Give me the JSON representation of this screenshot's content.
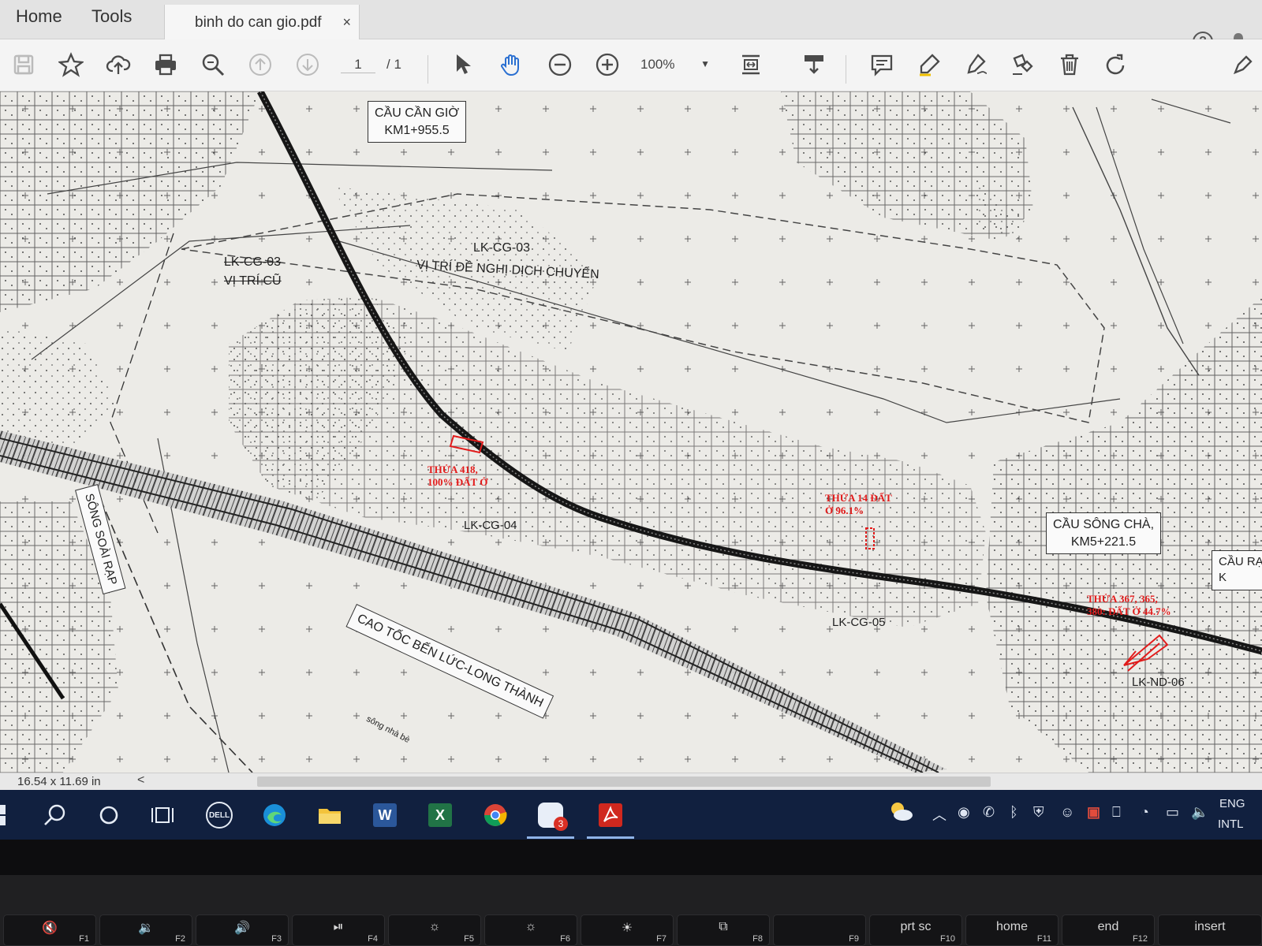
{
  "menu": {
    "home": "Home",
    "tools": "Tools"
  },
  "tab": {
    "title": "binh do can gio.pdf",
    "close": "×"
  },
  "header": {
    "help": "?"
  },
  "toolbar": {
    "page_current": "1",
    "page_total": "/ 1",
    "zoom": "100%"
  },
  "map": {
    "bridge_can_gio": {
      "line1": "CẦU CẦN GIỜ",
      "line2": "KM1+955.5"
    },
    "lk_cg_03_old": {
      "line1": "LK-CG-03",
      "line2": "VỊ TRÍ CŨ"
    },
    "lk_cg_03_new": {
      "line1": "LK-CG-03",
      "line2": "VỊ TRÍ ĐỀ NGHỊ DỊCH CHUYỂN"
    },
    "river_soai_rap": "SÔNG SOÀI RẠP",
    "highway": "CAO TỐC BẾN LỨC-LONG THÀNH",
    "lk_cg_04": "LK-CG-04",
    "lk_cg_05": "LK-CG-05",
    "lk_nd_06": "LK-ND-06",
    "bridge_song_cha": {
      "line1": "CẦU SÔNG CHÀ,",
      "line2": "KM5+221.5"
    },
    "bridge_ra": {
      "line1": "CẦU RẠ",
      "line2": "K"
    },
    "parcel_418": {
      "line1": "THỬA 418,",
      "line2": "100% ĐẤT Ở"
    },
    "parcel_14": {
      "line1": "THỬA 14 ĐẤT",
      "line2": "Ở 96.1%"
    },
    "parcel_367": {
      "line1": "THỬA 367, 365,",
      "line2": "380: ĐẤT Ở 44.7%"
    },
    "river_nha_be": "sông nhà bè"
  },
  "status": {
    "page_size": "16.54 x 11.69 in",
    "scroll_left": "<"
  },
  "taskbar": {
    "dell": "DELL",
    "word": "W",
    "excel": "X",
    "zalo_badge": "3",
    "lang_line1": "ENG",
    "lang_line2": "INTL"
  },
  "keyboard": {
    "keys": [
      {
        "fn": "F1",
        "main": "🔇"
      },
      {
        "fn": "F2",
        "main": "🔉"
      },
      {
        "fn": "F3",
        "main": "🔊"
      },
      {
        "fn": "F4",
        "main": "⏯"
      },
      {
        "fn": "F5",
        "main": "☼"
      },
      {
        "fn": "F6",
        "main": "☼"
      },
      {
        "fn": "F7",
        "main": "☀"
      },
      {
        "fn": "F8",
        "main": "⧉"
      },
      {
        "fn": "F9",
        "main": ""
      },
      {
        "fn": "F10",
        "main": "prt sc"
      },
      {
        "fn": "F11",
        "main": "home"
      },
      {
        "fn": "F12",
        "main": "end"
      },
      {
        "fn": "",
        "main": "insert"
      }
    ]
  },
  "colors": {
    "accent_red": "#e21b1b",
    "taskbar": "#11203f"
  }
}
